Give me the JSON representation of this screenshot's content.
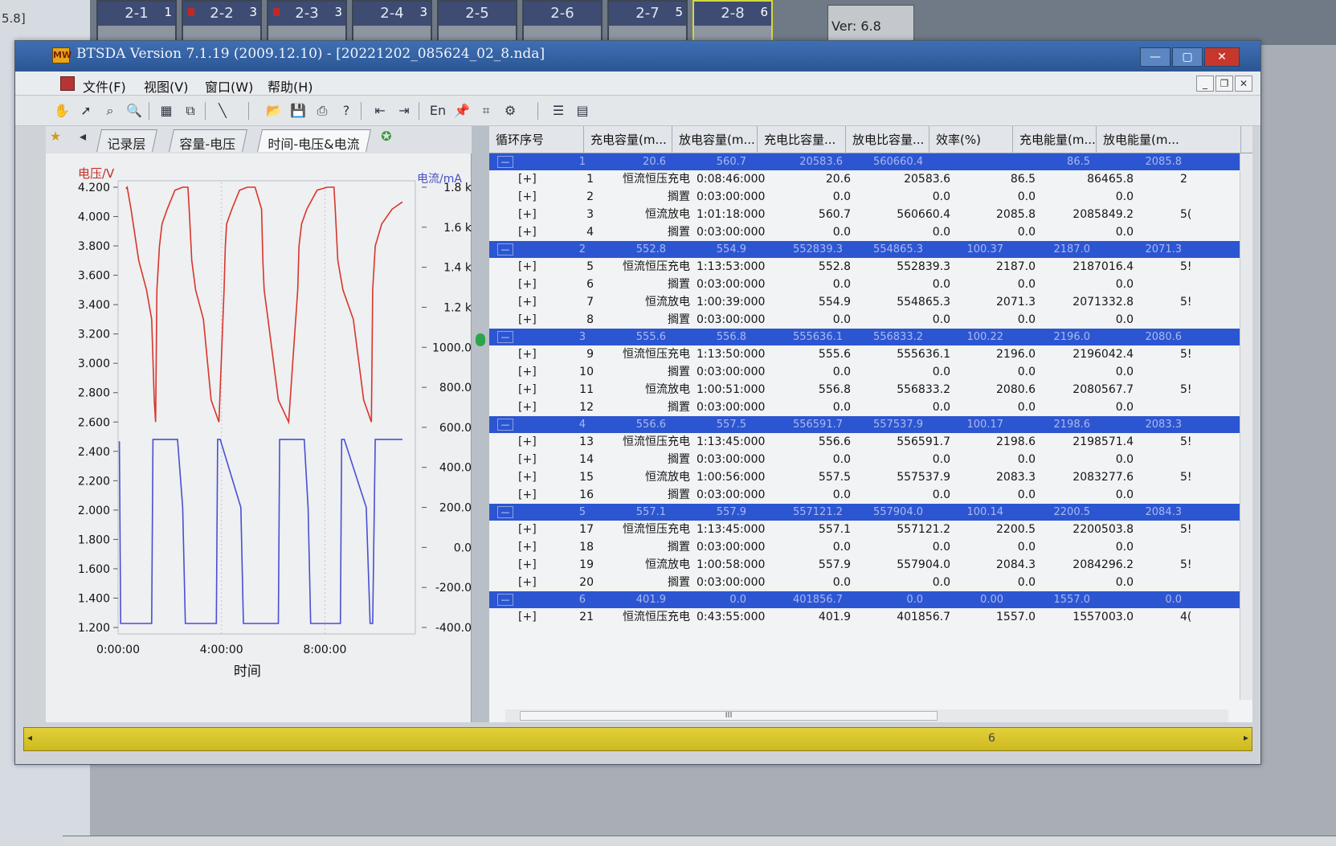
{
  "background": {
    "left_text": "5.8]",
    "channels": [
      {
        "label": "2-1",
        "num": "1",
        "sub": "",
        "dot": false
      },
      {
        "label": "2-2",
        "num": "3",
        "sub": "",
        "dot": true
      },
      {
        "label": "2-3",
        "num": "3",
        "sub": "",
        "dot": true
      },
      {
        "label": "2-4",
        "num": "3",
        "sub": "",
        "dot": false
      },
      {
        "label": "2-5",
        "num": "",
        "sub": "",
        "dot": false
      },
      {
        "label": "2-6",
        "num": "",
        "sub": "",
        "dot": false
      },
      {
        "label": "2-7",
        "num": "5",
        "sub": "",
        "dot": false
      },
      {
        "label": "2-8",
        "num": "6",
        "sub": "",
        "dot": false
      }
    ],
    "version_tile": "Ver: 6.8"
  },
  "window": {
    "title": "BTSDA Version 7.1.19 (2009.12.10)   - [20221202_085624_02_8.nda]",
    "menus": [
      "文件(F)",
      "视图(V)",
      "窗口(W)",
      "帮助(H)"
    ]
  },
  "tabs": [
    "记录层",
    "容量-电压",
    "时间-电压&电流"
  ],
  "chart": {
    "y_left_label": "电压/V",
    "y_right_label": "电流/mA",
    "x_label": "时间",
    "y_left_ticks": [
      "4.200",
      "4.000",
      "3.800",
      "3.600",
      "3.400",
      "3.200",
      "3.000",
      "2.800",
      "2.600",
      "2.400",
      "2.200",
      "2.000",
      "1.800",
      "1.600",
      "1.400",
      "1.200"
    ],
    "y_right_ticks": [
      "1.8 k",
      "1.6 k",
      "1.4 k",
      "1.2 k",
      "1000.0",
      "800.0",
      "600.0",
      "400.0",
      "200.0",
      "0.0",
      "-200.0",
      "-400.0"
    ],
    "x_ticks": [
      "0:00:00",
      "4:00:00",
      "8:00:00"
    ]
  },
  "chart_data": {
    "type": "line",
    "title": "",
    "xlabel": "时间",
    "ylabel": "电压/V",
    "y2label": "电流/mA",
    "ylim": [
      1.2,
      4.2
    ],
    "y2lim": [
      -400,
      1800
    ],
    "xlim_hours": [
      0,
      11.5
    ],
    "series": [
      {
        "name": "电压/V",
        "color": "#d9352a",
        "axis": "left",
        "x_hours": [
          0.3,
          0.35,
          0.5,
          0.8,
          1.1,
          1.3,
          1.4,
          1.45,
          1.5,
          1.6,
          1.7,
          1.9,
          2.2,
          2.5,
          2.7,
          2.75,
          2.85,
          3.0,
          3.3,
          3.6,
          3.9,
          4.1,
          4.15,
          4.2,
          4.4,
          4.7,
          5.0,
          5.3,
          5.55,
          5.6,
          5.65,
          5.8,
          6.2,
          6.6,
          6.95,
          7.0,
          7.1,
          7.3,
          7.7,
          8.1,
          8.35,
          8.4,
          8.5,
          8.7,
          9.1,
          9.5,
          9.8,
          9.85,
          9.95,
          10.2,
          10.6,
          11.0
        ],
        "values": [
          4.19,
          4.2,
          4.05,
          3.7,
          3.5,
          3.3,
          2.75,
          2.6,
          3.5,
          3.8,
          3.95,
          4.05,
          4.18,
          4.2,
          4.2,
          4.05,
          3.7,
          3.5,
          3.3,
          2.75,
          2.6,
          3.5,
          3.8,
          3.95,
          4.05,
          4.18,
          4.2,
          4.2,
          4.05,
          3.7,
          3.5,
          3.3,
          2.75,
          2.6,
          3.5,
          3.8,
          3.95,
          4.05,
          4.18,
          4.2,
          4.2,
          4.05,
          3.7,
          3.5,
          3.3,
          2.75,
          2.6,
          3.5,
          3.8,
          3.95,
          4.05,
          4.1
        ]
      },
      {
        "name": "电流/mA",
        "color": "#4a4fd0",
        "axis": "right",
        "x_hours": [
          0.05,
          0.1,
          0.15,
          1.3,
          1.35,
          1.45,
          2.3,
          2.5,
          2.6,
          2.75,
          3.8,
          3.85,
          3.95,
          4.75,
          4.85,
          5.0,
          5.1,
          6.2,
          6.25,
          6.35,
          7.2,
          7.35,
          7.45,
          7.55,
          8.6,
          8.65,
          8.75,
          9.6,
          9.75,
          9.85,
          9.95,
          11.0
        ],
        "values": [
          530,
          -380,
          -380,
          -380,
          540,
          540,
          540,
          200,
          -380,
          -380,
          -380,
          540,
          540,
          200,
          -380,
          -380,
          -380,
          -380,
          540,
          540,
          540,
          200,
          -380,
          -380,
          -380,
          540,
          540,
          200,
          -380,
          -380,
          540,
          540
        ]
      }
    ]
  },
  "table": {
    "headers": [
      "循环序号",
      "充电容量(m...",
      "放电容量(m...",
      "充电比容量...",
      "放电比容量...",
      "效率(%)",
      "充电能量(m...",
      "放电能量(m..."
    ],
    "groups": [
      {
        "id": "1",
        "toggle": "—",
        "summary": [
          "20.6",
          "560.7",
          "20583.6",
          "560660.4",
          "",
          "86.5",
          "2085.8"
        ],
        "steps": [
          [
            "[+]",
            "1",
            "恒流恒压充电",
            "0:08:46:000",
            "20.6",
            "20583.6",
            "86.5",
            "86465.8",
            "2"
          ],
          [
            "[+]",
            "2",
            "搁置",
            "0:03:00:000",
            "0.0",
            "0.0",
            "0.0",
            "0.0",
            ""
          ],
          [
            "[+]",
            "3",
            "恒流放电",
            "1:01:18:000",
            "560.7",
            "560660.4",
            "2085.8",
            "2085849.2",
            "5("
          ],
          [
            "[+]",
            "4",
            "搁置",
            "0:03:00:000",
            "0.0",
            "0.0",
            "0.0",
            "0.0",
            ""
          ]
        ]
      },
      {
        "id": "2",
        "toggle": "—",
        "summary": [
          "552.8",
          "554.9",
          "552839.3",
          "554865.3",
          "100.37",
          "2187.0",
          "2071.3"
        ],
        "steps": [
          [
            "[+]",
            "5",
            "恒流恒压充电",
            "1:13:53:000",
            "552.8",
            "552839.3",
            "2187.0",
            "2187016.4",
            "5!"
          ],
          [
            "[+]",
            "6",
            "搁置",
            "0:03:00:000",
            "0.0",
            "0.0",
            "0.0",
            "0.0",
            ""
          ],
          [
            "[+]",
            "7",
            "恒流放电",
            "1:00:39:000",
            "554.9",
            "554865.3",
            "2071.3",
            "2071332.8",
            "5!"
          ],
          [
            "[+]",
            "8",
            "搁置",
            "0:03:00:000",
            "0.0",
            "0.0",
            "0.0",
            "0.0",
            ""
          ]
        ]
      },
      {
        "id": "3",
        "toggle": "—",
        "summary": [
          "555.6",
          "556.8",
          "555636.1",
          "556833.2",
          "100.22",
          "2196.0",
          "2080.6"
        ],
        "steps": [
          [
            "[+]",
            "9",
            "恒流恒压充电",
            "1:13:50:000",
            "555.6",
            "555636.1",
            "2196.0",
            "2196042.4",
            "5!"
          ],
          [
            "[+]",
            "10",
            "搁置",
            "0:03:00:000",
            "0.0",
            "0.0",
            "0.0",
            "0.0",
            ""
          ],
          [
            "[+]",
            "11",
            "恒流放电",
            "1:00:51:000",
            "556.8",
            "556833.2",
            "2080.6",
            "2080567.7",
            "5!"
          ],
          [
            "[+]",
            "12",
            "搁置",
            "0:03:00:000",
            "0.0",
            "0.0",
            "0.0",
            "0.0",
            ""
          ]
        ]
      },
      {
        "id": "4",
        "toggle": "—",
        "summary": [
          "556.6",
          "557.5",
          "556591.7",
          "557537.9",
          "100.17",
          "2198.6",
          "2083.3"
        ],
        "steps": [
          [
            "[+]",
            "13",
            "恒流恒压充电",
            "1:13:45:000",
            "556.6",
            "556591.7",
            "2198.6",
            "2198571.4",
            "5!"
          ],
          [
            "[+]",
            "14",
            "搁置",
            "0:03:00:000",
            "0.0",
            "0.0",
            "0.0",
            "0.0",
            ""
          ],
          [
            "[+]",
            "15",
            "恒流放电",
            "1:00:56:000",
            "557.5",
            "557537.9",
            "2083.3",
            "2083277.6",
            "5!"
          ],
          [
            "[+]",
            "16",
            "搁置",
            "0:03:00:000",
            "0.0",
            "0.0",
            "0.0",
            "0.0",
            ""
          ]
        ]
      },
      {
        "id": "5",
        "toggle": "—",
        "summary": [
          "557.1",
          "557.9",
          "557121.2",
          "557904.0",
          "100.14",
          "2200.5",
          "2084.3"
        ],
        "steps": [
          [
            "[+]",
            "17",
            "恒流恒压充电",
            "1:13:45:000",
            "557.1",
            "557121.2",
            "2200.5",
            "2200503.8",
            "5!"
          ],
          [
            "[+]",
            "18",
            "搁置",
            "0:03:00:000",
            "0.0",
            "0.0",
            "0.0",
            "0.0",
            ""
          ],
          [
            "[+]",
            "19",
            "恒流放电",
            "1:00:58:000",
            "557.9",
            "557904.0",
            "2084.3",
            "2084296.2",
            "5!"
          ],
          [
            "[+]",
            "20",
            "搁置",
            "0:03:00:000",
            "0.0",
            "0.0",
            "0.0",
            "0.0",
            ""
          ]
        ]
      },
      {
        "id": "6",
        "toggle": "—",
        "summary": [
          "401.9",
          "0.0",
          "401856.7",
          "0.0",
          "0.00",
          "1557.0",
          "0.0"
        ],
        "steps": [
          [
            "[+]",
            "21",
            "恒流恒压充电",
            "0:43:55:000",
            "401.9",
            "401856.7",
            "1557.0",
            "1557003.0",
            "4("
          ]
        ]
      }
    ]
  },
  "status": {
    "value": "6"
  }
}
